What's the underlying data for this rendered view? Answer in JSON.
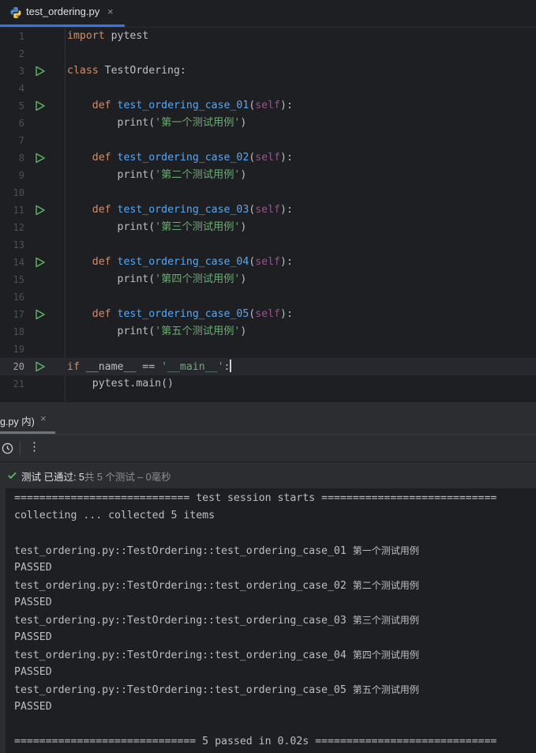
{
  "tab": {
    "title": "test_ordering.py",
    "close": "×"
  },
  "editor": {
    "lines": [
      {
        "n": "1",
        "parts": [
          [
            "kw",
            "import"
          ],
          [
            "t",
            " pytest"
          ]
        ]
      },
      {
        "n": "2",
        "parts": []
      },
      {
        "n": "3",
        "parts": [
          [
            "kw",
            "class"
          ],
          [
            "t",
            " TestOrdering:"
          ]
        ],
        "run": true
      },
      {
        "n": "4",
        "parts": []
      },
      {
        "n": "5",
        "parts": [
          [
            "t",
            "    "
          ],
          [
            "kw",
            "def"
          ],
          [
            "t",
            " "
          ],
          [
            "fn",
            "test_ordering_case_01"
          ],
          [
            "t",
            "("
          ],
          [
            "self",
            "self"
          ],
          [
            "t",
            "):"
          ]
        ],
        "run": true
      },
      {
        "n": "6",
        "parts": [
          [
            "t",
            "        print("
          ],
          [
            "str",
            "'第一个测试用例'"
          ],
          [
            "t",
            ")"
          ]
        ]
      },
      {
        "n": "7",
        "parts": []
      },
      {
        "n": "8",
        "parts": [
          [
            "t",
            "    "
          ],
          [
            "kw",
            "def"
          ],
          [
            "t",
            " "
          ],
          [
            "fn",
            "test_ordering_case_02"
          ],
          [
            "t",
            "("
          ],
          [
            "self",
            "self"
          ],
          [
            "t",
            "):"
          ]
        ],
        "run": true
      },
      {
        "n": "9",
        "parts": [
          [
            "t",
            "        print("
          ],
          [
            "str",
            "'第二个测试用例'"
          ],
          [
            "t",
            ")"
          ]
        ]
      },
      {
        "n": "10",
        "parts": []
      },
      {
        "n": "11",
        "parts": [
          [
            "t",
            "    "
          ],
          [
            "kw",
            "def"
          ],
          [
            "t",
            " "
          ],
          [
            "fn",
            "test_ordering_case_03"
          ],
          [
            "t",
            "("
          ],
          [
            "self",
            "self"
          ],
          [
            "t",
            "):"
          ]
        ],
        "run": true
      },
      {
        "n": "12",
        "parts": [
          [
            "t",
            "        print("
          ],
          [
            "str",
            "'第三个测试用例'"
          ],
          [
            "t",
            ")"
          ]
        ]
      },
      {
        "n": "13",
        "parts": []
      },
      {
        "n": "14",
        "parts": [
          [
            "t",
            "    "
          ],
          [
            "kw",
            "def"
          ],
          [
            "t",
            " "
          ],
          [
            "fn",
            "test_ordering_case_04"
          ],
          [
            "t",
            "("
          ],
          [
            "self",
            "self"
          ],
          [
            "t",
            "):"
          ]
        ],
        "run": true
      },
      {
        "n": "15",
        "parts": [
          [
            "t",
            "        print("
          ],
          [
            "str",
            "'第四个测试用例'"
          ],
          [
            "t",
            ")"
          ]
        ]
      },
      {
        "n": "16",
        "parts": []
      },
      {
        "n": "17",
        "parts": [
          [
            "t",
            "    "
          ],
          [
            "kw",
            "def"
          ],
          [
            "t",
            " "
          ],
          [
            "fn",
            "test_ordering_case_05"
          ],
          [
            "t",
            "("
          ],
          [
            "self",
            "self"
          ],
          [
            "t",
            "):"
          ]
        ],
        "run": true
      },
      {
        "n": "18",
        "parts": [
          [
            "t",
            "        print("
          ],
          [
            "str",
            "'第五个测试用例'"
          ],
          [
            "t",
            ")"
          ]
        ]
      },
      {
        "n": "19",
        "parts": []
      },
      {
        "n": "20",
        "parts": [
          [
            "kw",
            "if"
          ],
          [
            "t",
            " __name__ == "
          ],
          [
            "str",
            "'__main__'"
          ],
          [
            "t",
            ":"
          ]
        ],
        "run": true,
        "current": true
      },
      {
        "n": "21",
        "parts": [
          [
            "t",
            "    pytest.main()"
          ]
        ]
      }
    ]
  },
  "run_panel": {
    "tab_label": "g.py 内)",
    "tab_close": "×",
    "more": "⋮",
    "status": {
      "prefix": "测试 已通过: ",
      "count": "5",
      "suffix": "共 5 个测试 – 0毫秒"
    }
  },
  "console": {
    "lines": [
      "============================ test session starts ============================",
      "collecting ... collected 5 items",
      "",
      "test_ordering.py::TestOrdering::test_ordering_case_01 |第一个测试用例",
      "PASSED",
      "test_ordering.py::TestOrdering::test_ordering_case_02 |第二个测试用例",
      "PASSED",
      "test_ordering.py::TestOrdering::test_ordering_case_03 |第三个测试用例",
      "PASSED",
      "test_ordering.py::TestOrdering::test_ordering_case_04 |第四个测试用例",
      "PASSED",
      "test_ordering.py::TestOrdering::test_ordering_case_05 |第五个测试用例",
      "PASSED",
      "",
      "============================= 5 passed in 0.02s ============================="
    ]
  },
  "colors": {
    "accent": "#3574f0",
    "keyword": "#cf8e6d",
    "function": "#56a8f5",
    "string": "#6aab73",
    "self": "#94558d",
    "run_icon": "#5fb865"
  }
}
